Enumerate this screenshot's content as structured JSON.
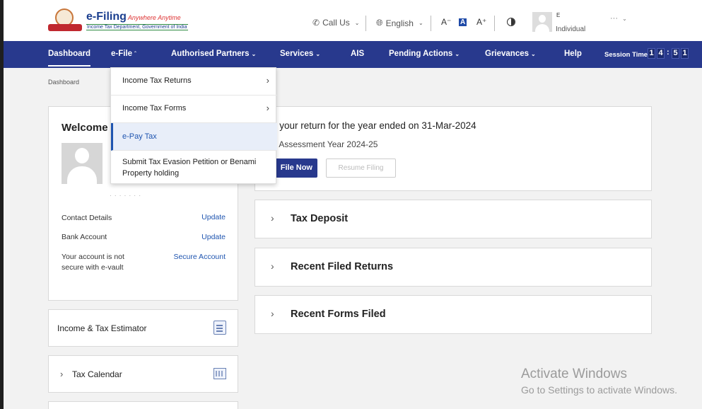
{
  "header": {
    "logo_title": "e-Filing",
    "logo_tagline": "Anywhere Anytime",
    "logo_subtitle": "Income Tax Department, Government of India",
    "call_us": "Call Us",
    "language": "English",
    "font_decrease": "A⁻",
    "font_default": "A",
    "font_increase": "A⁺",
    "user_name": "E",
    "user_role": "Individual",
    "user_menu": "···"
  },
  "nav": {
    "items": [
      {
        "label": "Dashboard"
      },
      {
        "label": "e-File"
      },
      {
        "label": "Authorised Partners"
      },
      {
        "label": "Services"
      },
      {
        "label": "AIS"
      },
      {
        "label": "Pending Actions"
      },
      {
        "label": "Grievances"
      },
      {
        "label": "Help"
      }
    ],
    "session_label": "Session Time",
    "session_digits": [
      "1",
      "4",
      "5",
      "1"
    ]
  },
  "dropdown": {
    "items": [
      {
        "label": "Income Tax Returns",
        "arrow": "›"
      },
      {
        "label": "Income Tax Forms",
        "arrow": "›"
      },
      {
        "label": "e-Pay Tax"
      },
      {
        "label": "Submit Tax Evasion Petition or Benami Property holding"
      }
    ]
  },
  "breadcrumb": "Dashboard",
  "welcome": {
    "title": "Welcome E",
    "contact_label": "Contact Details",
    "contact_link": "Update",
    "bank_label": "Bank Account",
    "bank_link": "Update",
    "vault_label": "Your account is not secure with e-vault",
    "vault_link": "Secure Account"
  },
  "side_cards": {
    "estimator": "Income & Tax Estimator",
    "calendar": "Tax Calendar"
  },
  "filing": {
    "title": "le your return for the year ended on 31-Mar-2024",
    "subtitle": "or Assessment Year 2024-25",
    "file_now": "File Now",
    "resume": "Resume Filing"
  },
  "accordions": [
    {
      "title": "Tax Deposit"
    },
    {
      "title": "Recent Filed Returns"
    },
    {
      "title": "Recent Forms Filed"
    }
  ],
  "watermark": {
    "line1": "Activate Windows",
    "line2": "Go to Settings to activate Windows."
  }
}
